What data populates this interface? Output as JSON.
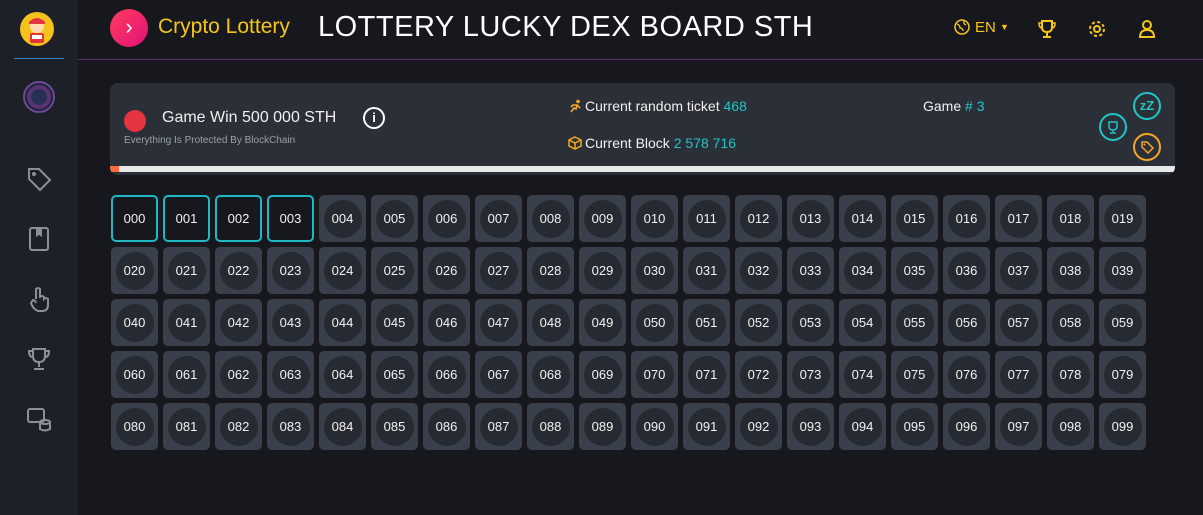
{
  "header": {
    "brand": "Crypto Lottery",
    "title": "LOTTERY LUCKY DEX BOARD STH",
    "language": "EN"
  },
  "game": {
    "prize": "Game Win 500 000 STH",
    "subtitle": "Everything Is Protected By BlockChain",
    "random_ticket_label": "Current random ticket",
    "random_ticket_value": "468",
    "block_label": "Current Block",
    "block_value": "2 578 716",
    "game_label": "Game",
    "game_value": "# 3",
    "sleep_label": "zZ",
    "progress": 0.008
  },
  "tickets": {
    "selected": [
      "000",
      "001",
      "002",
      "003"
    ],
    "numbers": [
      "000",
      "001",
      "002",
      "003",
      "004",
      "005",
      "006",
      "007",
      "008",
      "009",
      "010",
      "011",
      "012",
      "013",
      "014",
      "015",
      "016",
      "017",
      "018",
      "019",
      "020",
      "021",
      "022",
      "023",
      "024",
      "025",
      "026",
      "027",
      "028",
      "029",
      "030",
      "031",
      "032",
      "033",
      "034",
      "035",
      "036",
      "037",
      "038",
      "039",
      "040",
      "041",
      "042",
      "043",
      "044",
      "045",
      "046",
      "047",
      "048",
      "049",
      "050",
      "051",
      "052",
      "053",
      "054",
      "055",
      "056",
      "057",
      "058",
      "059",
      "060",
      "061",
      "062",
      "063",
      "064",
      "065",
      "066",
      "067",
      "068",
      "069",
      "070",
      "071",
      "072",
      "073",
      "074",
      "075",
      "076",
      "077",
      "078",
      "079",
      "080",
      "081",
      "082",
      "083",
      "084",
      "085",
      "086",
      "087",
      "088",
      "089",
      "090",
      "091",
      "092",
      "093",
      "094",
      "095",
      "096",
      "097",
      "098",
      "099"
    ]
  },
  "colors": {
    "accent_yellow": "#f5c518",
    "accent_cyan": "#21c4c4",
    "accent_orange": "#ff6a3d",
    "accent_red": "#e5333f"
  },
  "icons": {
    "sidebar": [
      "tag-icon",
      "book-icon",
      "hand-pointer-icon",
      "trophy-icon",
      "coins-icon"
    ],
    "topbar": [
      "globe-icon",
      "trophy-icon",
      "gear-icon",
      "user-icon"
    ]
  }
}
